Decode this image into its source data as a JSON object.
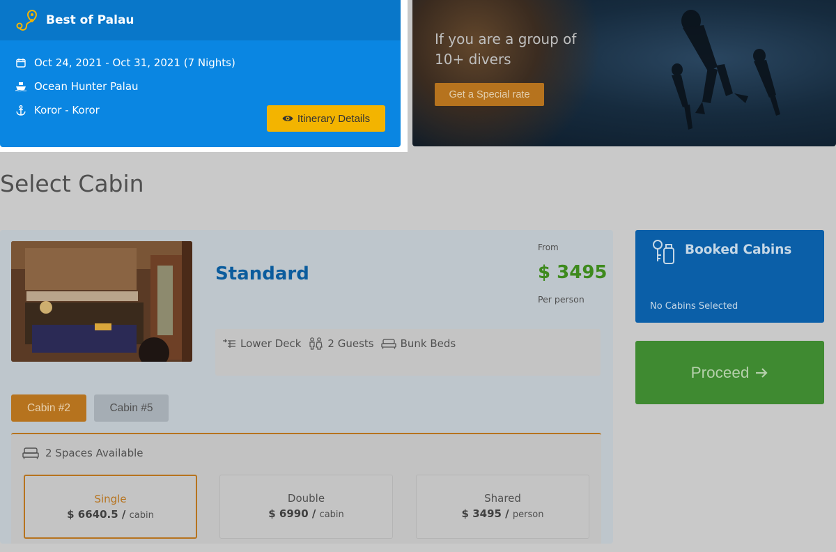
{
  "trip": {
    "title": "Best of Palau",
    "dates": "Oct 24, 2021 - Oct 31, 2021 (7 Nights)",
    "vessel": "Ocean Hunter Palau",
    "route": "Koror - Koror",
    "itinerary_button": "Itinerary Details"
  },
  "promo": {
    "line1": "If you are a group of",
    "line2": "10+ divers",
    "button": "Get a Special rate"
  },
  "section_title": "Select Cabin",
  "cabin": {
    "name": "Standard",
    "from_label": "From",
    "price": "$ 3495",
    "price_unit": "Per person",
    "features": {
      "deck": "Lower Deck",
      "guests": "2 Guests",
      "beds": "Bunk Beds"
    },
    "tabs": [
      {
        "label": "Cabin #2",
        "active": true
      },
      {
        "label": "Cabin #5",
        "active": false
      }
    ],
    "availability": "2 Spaces Available",
    "options": [
      {
        "name": "Single",
        "price": "$ 6640.5 /",
        "unit": "cabin",
        "selected": true
      },
      {
        "name": "Double",
        "price": "$ 6990 /",
        "unit": "cabin",
        "selected": false
      },
      {
        "name": "Shared",
        "price": "$ 3495 /",
        "unit": "person",
        "selected": false
      }
    ]
  },
  "booked": {
    "title": "Booked Cabins",
    "empty_text": "No Cabins Selected"
  },
  "proceed_label": "Proceed",
  "colors": {
    "trip_blue": "#0a86e2",
    "accent_orange": "#b6731e",
    "price_green": "#3e8a1d",
    "proceed_green": "#3f8a31",
    "booked_blue": "#0b5fa8"
  }
}
